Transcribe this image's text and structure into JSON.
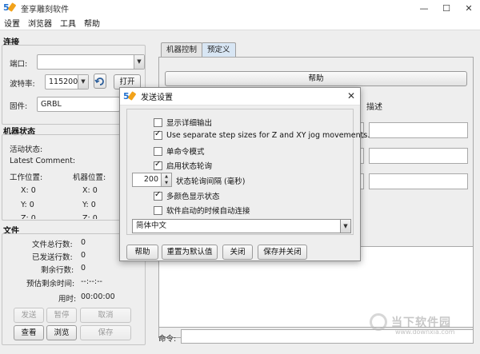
{
  "window": {
    "title": "雕刻软件",
    "title_prefix": "奎享",
    "controls": {
      "minimize": "—",
      "maximize": "☐",
      "close": "✕"
    }
  },
  "menu": [
    "设置",
    "浏览器",
    "工具",
    "帮助"
  ],
  "connection": {
    "section_title": "连接",
    "port_label": "端口:",
    "port_value": "",
    "baud_label": "波特率:",
    "baud_value": "115200",
    "open_button": "打开",
    "firmware_label": "固件:",
    "firmware_value": "GRBL"
  },
  "machine_state": {
    "section_title": "机器状态",
    "active_state_label": "活动状态:",
    "latest_comment_label": "Latest Comment:",
    "work_position_label": "工作位置:",
    "machine_position_label": "机器位置:",
    "work": {
      "x": "X: 0",
      "y": "Y: 0",
      "z": "Z: 0"
    },
    "machine": {
      "x": "X: 0",
      "y": "Y: 0",
      "z": "Z: 0"
    }
  },
  "file": {
    "section_title": "文件",
    "total_lines_label": "文件总行数:",
    "total_lines_value": "0",
    "sent_lines_label": "已发送行数:",
    "sent_lines_value": "0",
    "remaining_lines_label": "剩余行数:",
    "remaining_lines_value": "0",
    "est_remaining_label": "预估剩余时间:",
    "est_remaining_value": "--:--:--",
    "time_used_label": "用时:",
    "time_used_value": "00:00:00",
    "buttons": {
      "send": "发送",
      "pause": "暂停",
      "cancel": "取消",
      "view": "查看",
      "browse": "浏览",
      "save": "保存"
    }
  },
  "tabs": [
    "机器控制",
    "预定义"
  ],
  "macro": {
    "help_button": "帮助",
    "description_header": "描述"
  },
  "command": {
    "label": "命令:"
  },
  "dialog": {
    "title": "发送设置",
    "close": "✕",
    "options": [
      {
        "label": "显示详细输出",
        "checked": false
      },
      {
        "label": "Use separate step sizes for Z and XY jog movements.",
        "checked": true
      },
      {
        "label": "单命令模式",
        "checked": false
      },
      {
        "label": "启用状态轮询",
        "checked": true
      }
    ],
    "poll_interval_value": "200",
    "poll_interval_label": "状态轮询间隔 (毫秒)",
    "options2": [
      {
        "label": "多颜色显示状态",
        "checked": true
      },
      {
        "label": "软件启动的时候自动连接",
        "checked": false
      }
    ],
    "language_value": "简体中文",
    "buttons": {
      "help": "帮助",
      "reset": "重置为默认值",
      "close": "关闭",
      "save_close": "保存并关闭"
    }
  },
  "watermark": {
    "text": "当下软件园",
    "url": "www.downxia.com"
  }
}
